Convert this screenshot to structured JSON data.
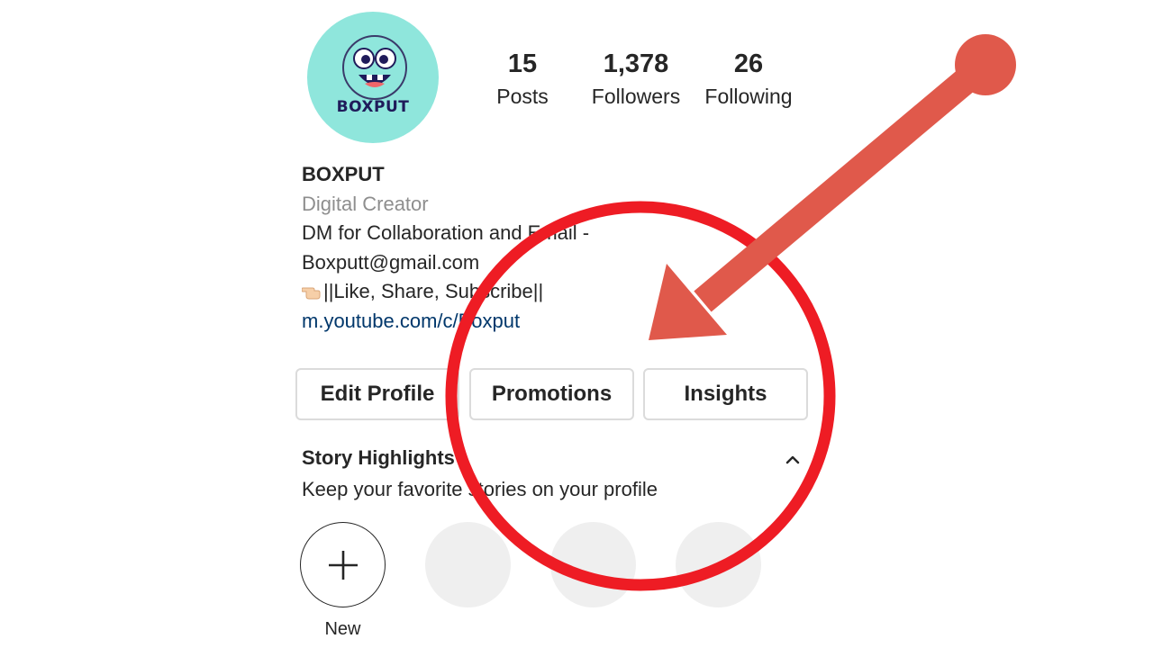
{
  "profile": {
    "avatar_text": "BOXPUT",
    "name": "BOXPUT",
    "category": "Digital Creator",
    "bio_line1": "DM for Collaboration and Email -",
    "bio_line2": "Boxputt@gmail.com",
    "bio_line3": "||Like, Share, Subscribe||",
    "link": "m.youtube.com/c/Boxput"
  },
  "stats": {
    "posts": {
      "value": "15",
      "label": "Posts"
    },
    "followers": {
      "value": "1,378",
      "label": "Followers"
    },
    "following": {
      "value": "26",
      "label": "Following"
    }
  },
  "buttons": {
    "edit_profile": "Edit Profile",
    "promotions": "Promotions",
    "insights": "Insights"
  },
  "highlights": {
    "title": "Story Highlights",
    "subtitle": "Keep your favorite stories on your profile",
    "new_label": "New"
  },
  "icons": {
    "bio_emoji": "pointing-hand-emoji",
    "collapse": "chevron-up-icon",
    "add": "plus-icon"
  },
  "colors": {
    "avatar_bg": "#8fe6dc",
    "link": "#00376b",
    "annotation_circle": "#ee1c24",
    "annotation_arrow": "#e0594b",
    "placeholder": "#efefef"
  }
}
